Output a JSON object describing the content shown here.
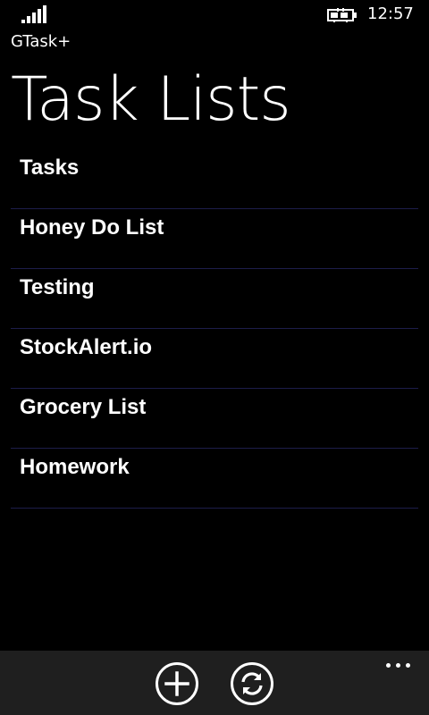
{
  "status_bar": {
    "signal_icon": "signal-strength-icon",
    "battery_icon": "battery-charging-icon",
    "time": "12:57"
  },
  "app": {
    "name": "GTask+"
  },
  "page": {
    "title": "Task Lists"
  },
  "task_lists": [
    {
      "label": "Tasks"
    },
    {
      "label": "Honey Do List"
    },
    {
      "label": "Testing"
    },
    {
      "label": "StockAlert.io"
    },
    {
      "label": "Grocery List"
    },
    {
      "label": "Homework"
    }
  ],
  "app_bar": {
    "buttons": [
      {
        "icon": "add-icon"
      },
      {
        "icon": "sync-icon"
      }
    ],
    "more_icon": "more-dots-icon"
  },
  "colors": {
    "background": "#000000",
    "text": "#ffffff",
    "separator": "#1d1d4a",
    "app_bar": "#1f1f1f"
  }
}
